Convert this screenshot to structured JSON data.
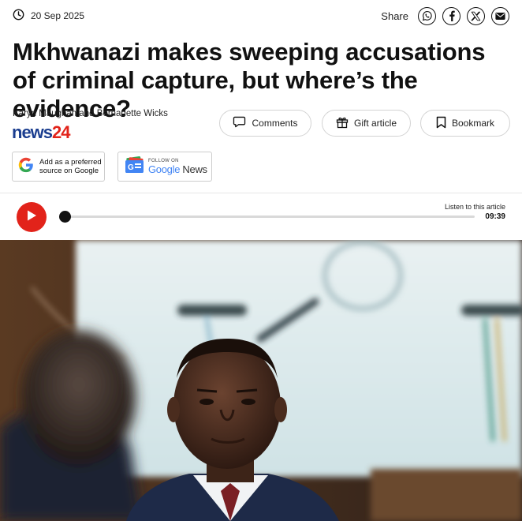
{
  "header": {
    "date": "20 Sep 2025",
    "share_label": "Share",
    "share_icons": [
      "whatsapp-icon",
      "facebook-icon",
      "x-icon",
      "email-icon"
    ]
  },
  "article": {
    "headline": "Mkhwanazi makes sweeping accusations of criminal capture, but where’s the evidence?",
    "authors": "Karyn Maughan and Bernadette Wicks"
  },
  "logo": {
    "part1": "news",
    "part2": "24"
  },
  "actions": {
    "comments_label": "Comments",
    "gift_label": "Gift article",
    "bookmark_label": "Bookmark"
  },
  "badges": {
    "preferred_line1": "Add as a preferred",
    "preferred_line2": "source on Google",
    "news_follow": "FOLLOW ON",
    "news_google": "Google",
    "news_news": " News"
  },
  "player": {
    "listen_label": "Listen to this article",
    "duration": "09:39",
    "progress": 0
  },
  "colors": {
    "brand_red": "#e2231a",
    "brand_blue": "#1a3d8f"
  }
}
